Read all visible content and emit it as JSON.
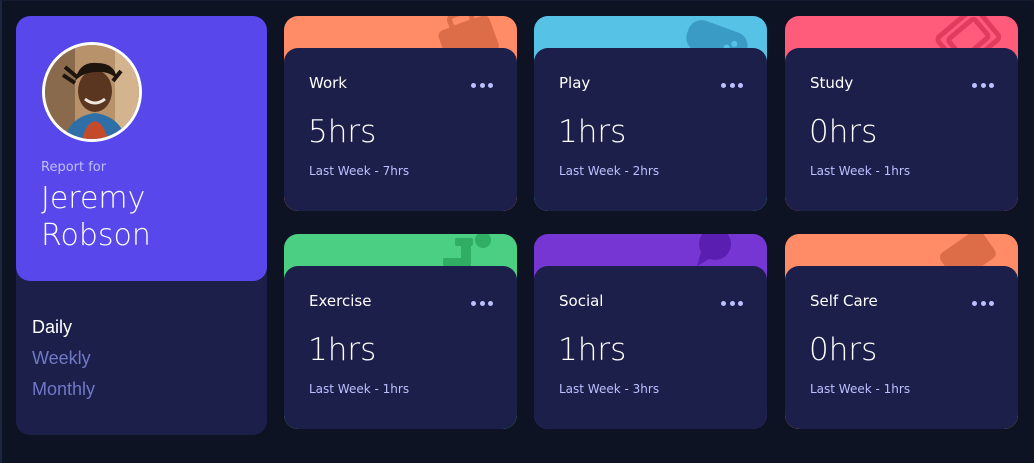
{
  "profile": {
    "report_label": "Report for",
    "name": "Jeremy Robson",
    "accent": "#5847eb"
  },
  "periods": [
    {
      "label": "Daily",
      "active": true
    },
    {
      "label": "Weekly",
      "active": false
    },
    {
      "label": "Monthly",
      "active": false
    }
  ],
  "cards": [
    {
      "title": "Work",
      "hours": "5hrs",
      "previous": "Last Week - 7hrs",
      "color": "#ff8c66",
      "icon": "briefcase-icon"
    },
    {
      "title": "Play",
      "hours": "1hrs",
      "previous": "Last Week - 2hrs",
      "color": "#56c2e6",
      "icon": "gamepad-icon"
    },
    {
      "title": "Study",
      "hours": "0hrs",
      "previous": "Last Week - 1hrs",
      "color": "#ff5c7c",
      "icon": "book-icon"
    },
    {
      "title": "Exercise",
      "hours": "1hrs",
      "previous": "Last Week - 1hrs",
      "color": "#4bcf82",
      "icon": "runner-icon"
    },
    {
      "title": "Social",
      "hours": "1hrs",
      "previous": "Last Week - 3hrs",
      "color": "#7536d3",
      "icon": "chat-bubble-icon"
    },
    {
      "title": "Self Care",
      "hours": "0hrs",
      "previous": "Last Week - 1hrs",
      "color": "#f1c75b",
      "icon": "heart-icon"
    }
  ],
  "colors": {
    "background": "#0d1323",
    "card_body": "#1c1f4a",
    "muted_text": "#bbc0ff",
    "inactive_period": "#7078c9"
  }
}
